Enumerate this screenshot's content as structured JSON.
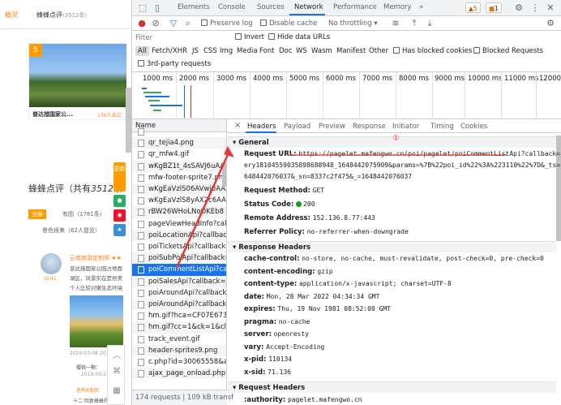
{
  "webpage": {
    "tabs": [
      {
        "label": "概况"
      },
      {
        "label": "蜂蜂点评",
        "count": "(3512条)"
      }
    ],
    "gallery": {
      "rank": "5",
      "caption": "普达措国家公...",
      "subcaption": "130人去过"
    },
    "review_title_prefix": "蜂蜂点评（共有",
    "review_count": "3512",
    "review_title_suffix": "条",
    "filters": {
      "all": "全部",
      "with_images": "有图（1781条）",
      "good": "景色很美（62人提及）"
    },
    "review": {
      "user": "云南旅游定制师 ★★",
      "level": "LV.41",
      "lines": [
        "普达措国家公园占地面",
        "湖区，风景实在是很美",
        "个人比较对懒生态环境"
      ],
      "date": "2019-03-08 20:17"
    },
    "replies": {
      "r1": "樱桃一颗：",
      "r1_date": "2019-05-2",
      "r2": "还有8条回",
      "r3": "十二 回复蜂蜂的三"
    },
    "share": [
      "更新",
      "分享"
    ],
    "tools": [
      "︿",
      "⌘",
      "▦"
    ]
  },
  "devtools": {
    "top_tabs": [
      "Elements",
      "Console",
      "Sources",
      "Network",
      "Performance",
      "Memory",
      "»"
    ],
    "active_tab": "Network",
    "warnings": "▲5",
    "issues": "1",
    "toolbar": {
      "preserve_log": "Preserve log",
      "disable_cache": "Disable cache",
      "throttling": "No throttling"
    },
    "filter": {
      "placeholder": "Filter",
      "invert": "Invert",
      "hide_data_urls": "Hide data URLs",
      "types": [
        "All",
        "Fetch/XHR",
        "JS",
        "CSS",
        "Img",
        "Media",
        "Font",
        "Doc",
        "WS",
        "Wasm",
        "Manifest",
        "Other"
      ],
      "blocked_cookies": "Has blocked cookies",
      "blocked_requests": "Blocked Requests",
      "third_party": "3rd-party requests"
    },
    "timeline_ticks": [
      "1000 ms",
      "2000 ms",
      "3000 ms",
      "4000 ms",
      "5000 ms",
      "6000 ms",
      "7000 ms",
      "8000 ms",
      "9000 ms",
      "10000 ms",
      "11000 ms",
      "12000"
    ],
    "list_header": "Name",
    "requests": [
      "",
      "qr_tejia4.png",
      "qr_mfw4.gif",
      "wKgBZ1t_4sSAVJ6uAAAl",
      "mfw-footer-sprite7.png",
      "wKgEaVzlS06AVwj0AAA",
      "wKgEaVzlS8yAX2c6AAA",
      "rBW26WHoLNoOKEb8",
      "pageViewHeadInfo?call",
      "poiLocationApi?callback",
      "poiTicketsApi?callback=",
      "poiSubPoiApi?callback=",
      "poiCommentListApi?call",
      "poiSalesApi?callback=j",
      "poiAroundApi?callback",
      "poiAroundApi?callback",
      "hm.gif?hca=CF07E6735",
      "hm.gif?cc=1&ck=1&cl=",
      "track_event.gif",
      "header-sprites9.png",
      "c.php?id=30065558&as",
      "ajax_page_onload.php?"
    ],
    "selected_request": "poiCommentListApi?call",
    "status_bar": "174 requests | 109 kB transf",
    "detail_tabs": [
      "Headers",
      "Payload",
      "Preview",
      "Response",
      "Initiator",
      "Timing",
      "Cookies"
    ],
    "active_detail_tab": "Headers",
    "close_symbol": "×",
    "general": {
      "title": "General",
      "url_label": "Request URL:",
      "url_1": "https://pagelet.mafengwo.cn/poi/pagelet/poiCommentListApi?callback=jQu",
      "url_2": "ery18104559035898688948_1648442075909&params=%7B%22poi_id%22%3A%223110%22%7D&_ts=1",
      "url_3": "648442076037&_sn=8337c2f475&_=1648442076037",
      "method_label": "Request Method:",
      "method": "GET",
      "status_label": "Status Code:",
      "status": "200",
      "remote_label": "Remote Address:",
      "remote": "152.136.8.77:443",
      "referrer_label": "Referrer Policy:",
      "referrer": "no-referrer-when-downgrade"
    },
    "response_headers": {
      "title": "Response Headers",
      "rows": [
        [
          "cache-control:",
          "no-store, no-cache, must-revalidate, post-check=0, pre-check=0"
        ],
        [
          "content-encoding:",
          "gzip"
        ],
        [
          "content-type:",
          "application/x-javascript; charset=UTF-8"
        ],
        [
          "date:",
          "Mon, 28 Mar 2022 04:34:34 GMT"
        ],
        [
          "expires:",
          "Thu, 19 Nov 1981 08:52:00 GMT"
        ],
        [
          "pragma:",
          "no-cache"
        ],
        [
          "server:",
          "openresty"
        ],
        [
          "vary:",
          "Accept-Encoding"
        ],
        [
          "x-pid:",
          "110134"
        ],
        [
          "x-sid:",
          "71.136"
        ]
      ]
    },
    "request_headers": {
      "title": "Request Headers",
      "authority_label": ":authority:",
      "authority": "pagelet.mafengwo.cn"
    },
    "annotation": "①",
    "colors": {
      "accent": "#1a73e8",
      "annotation": "#e53935",
      "status_ok": "#0ca30c"
    }
  }
}
